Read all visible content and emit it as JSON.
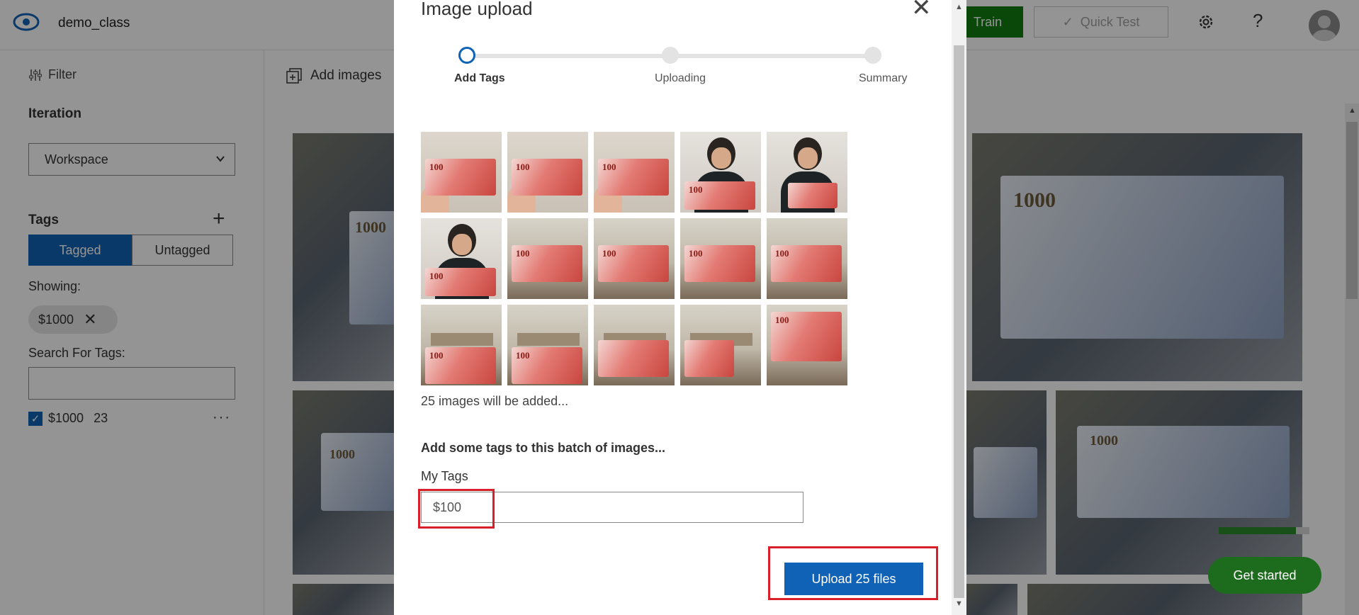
{
  "header": {
    "project_name": "demo_class",
    "train_label": "Train",
    "quick_test_label": "Quick Test"
  },
  "sidebar": {
    "filter_label": "Filter",
    "iteration_heading": "Iteration",
    "iteration_value": "Workspace",
    "tags_heading": "Tags",
    "tagged_label": "Tagged",
    "untagged_label": "Untagged",
    "showing_label": "Showing:",
    "showing_chip": "$1000",
    "search_label": "Search For Tags:",
    "search_value": "",
    "tag_items": [
      {
        "name": "$1000",
        "count": "23",
        "checked": true
      }
    ]
  },
  "main": {
    "add_images_label": "Add images",
    "bill_number": "1000",
    "get_started_label": "Get started",
    "progress": 0.85
  },
  "modal": {
    "title": "Image upload",
    "steps": [
      "Add Tags",
      "Uploading",
      "Summary"
    ],
    "active_step": 0,
    "thumb_number": "100",
    "images_count_text": "25 images will be added...",
    "batch_tags_heading": "Add some tags to this batch of images...",
    "my_tags_label": "My Tags",
    "tag_input_value": "$100",
    "upload_button_label": "Upload 25 files"
  },
  "colors": {
    "primary": "#0f62b6",
    "train": "#107c10",
    "highlight": "#d9202a"
  }
}
